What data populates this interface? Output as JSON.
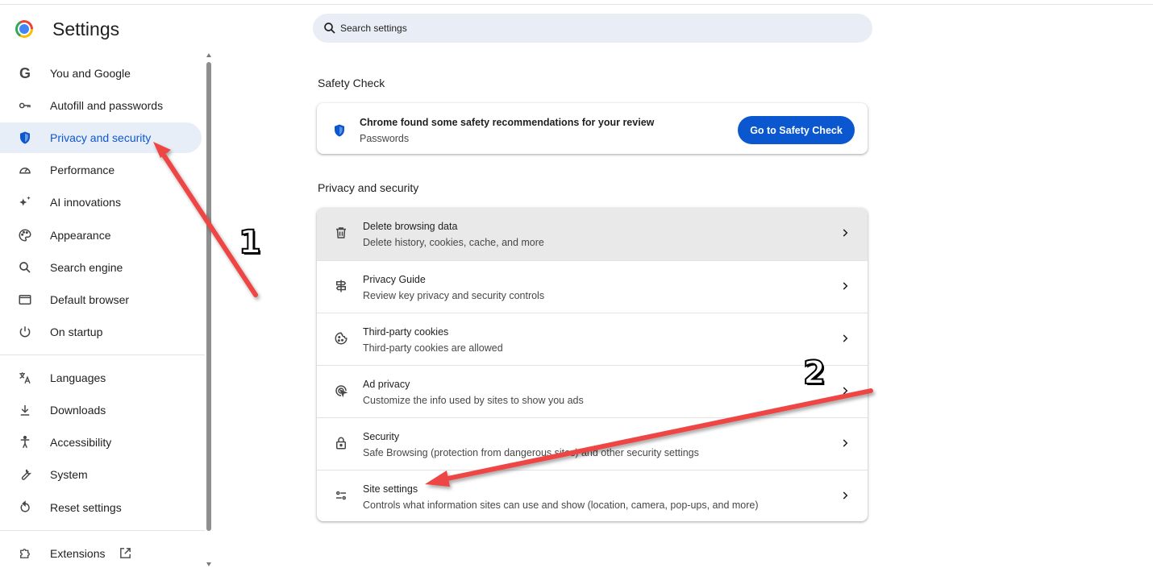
{
  "header": {
    "title": "Settings",
    "search_placeholder": "Search settings"
  },
  "sidebar": {
    "items": [
      {
        "label": "You and Google",
        "icon": "google-g-icon"
      },
      {
        "label": "Autofill and passwords",
        "icon": "key-icon"
      },
      {
        "label": "Privacy and security",
        "icon": "shield-icon",
        "active": true
      },
      {
        "label": "Performance",
        "icon": "speedometer-icon"
      },
      {
        "label": "AI innovations",
        "icon": "sparkle-icon"
      },
      {
        "label": "Appearance",
        "icon": "palette-icon"
      },
      {
        "label": "Search engine",
        "icon": "search-icon"
      },
      {
        "label": "Default browser",
        "icon": "browser-window-icon"
      },
      {
        "label": "On startup",
        "icon": "power-icon"
      },
      {
        "label": "Languages",
        "icon": "translate-icon"
      },
      {
        "label": "Downloads",
        "icon": "download-icon"
      },
      {
        "label": "Accessibility",
        "icon": "accessibility-icon"
      },
      {
        "label": "System",
        "icon": "wrench-icon"
      },
      {
        "label": "Reset settings",
        "icon": "reset-icon"
      },
      {
        "label": "Extensions",
        "icon": "puzzle-icon"
      }
    ]
  },
  "main": {
    "safety_check": {
      "heading": "Safety Check",
      "title": "Chrome found some safety recommendations for your review",
      "subtitle": "Passwords",
      "button": "Go to Safety Check"
    },
    "privacy": {
      "heading": "Privacy and security",
      "rows": [
        {
          "title": "Delete browsing data",
          "subtitle": "Delete history, cookies, cache, and more",
          "icon": "trash-icon"
        },
        {
          "title": "Privacy Guide",
          "subtitle": "Review key privacy and security controls",
          "icon": "signpost-icon"
        },
        {
          "title": "Third-party cookies",
          "subtitle": "Third-party cookies are allowed",
          "icon": "cookie-icon"
        },
        {
          "title": "Ad privacy",
          "subtitle": "Customize the info used by sites to show you ads",
          "icon": "ad-privacy-icon"
        },
        {
          "title": "Security",
          "subtitle": "Safe Browsing (protection from dangerous sites) and other security settings",
          "icon": "lock-icon"
        },
        {
          "title": "Site settings",
          "subtitle": "Controls what information sites can use and show (location, camera, pop-ups, and more)",
          "icon": "tune-icon"
        }
      ]
    }
  },
  "annotations": {
    "step1": "1",
    "step2": "2",
    "arrow_color": "#ee4444"
  },
  "colors": {
    "accent": "#0b57d0",
    "active_bg": "#e8eef8",
    "search_bg": "#e9eef6"
  }
}
